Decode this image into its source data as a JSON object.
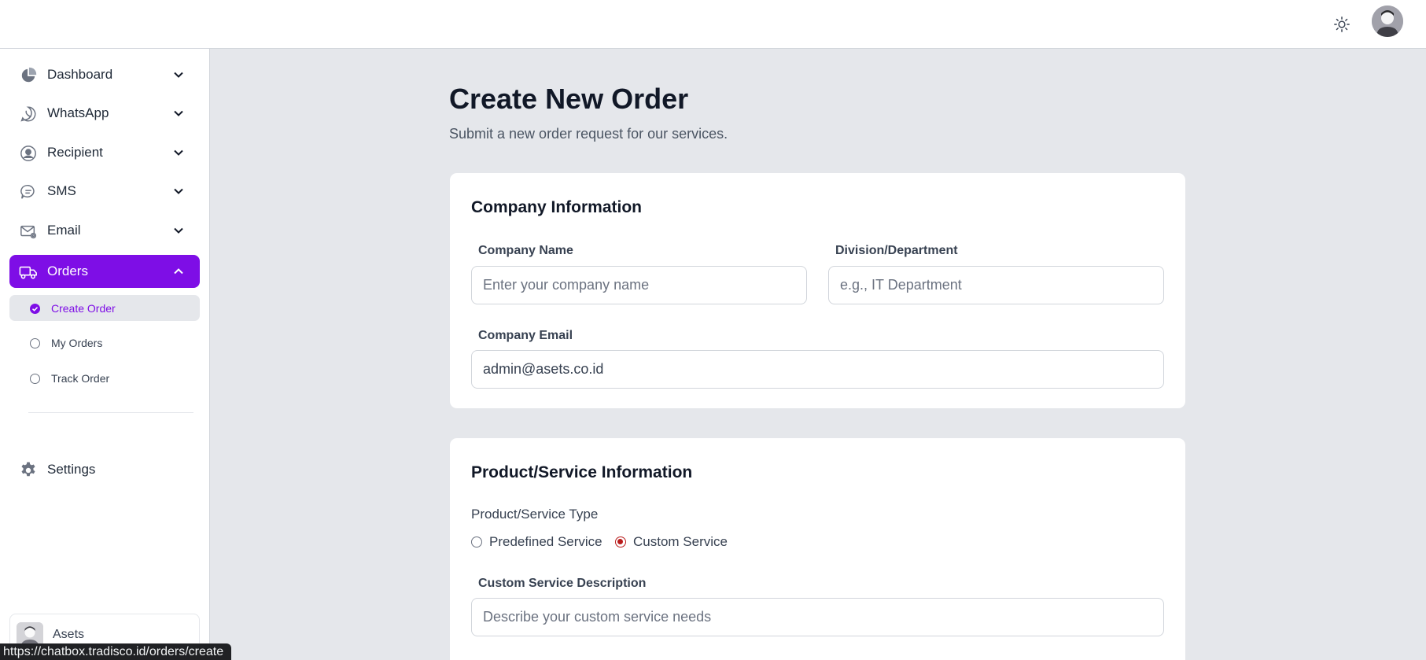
{
  "header": {
    "theme_icon": "sun-icon",
    "avatar_icon": "user-avatar"
  },
  "sidebar": {
    "items": [
      {
        "label": "Dashboard",
        "icon": "pie-chart-icon"
      },
      {
        "label": "WhatsApp",
        "icon": "whatsapp-icon"
      },
      {
        "label": "Recipient",
        "icon": "user-circle-icon"
      },
      {
        "label": "SMS",
        "icon": "chat-bubble-icon"
      },
      {
        "label": "Email",
        "icon": "envelope-icon"
      },
      {
        "label": "Orders",
        "icon": "truck-icon",
        "expanded": true
      }
    ],
    "sub_items": [
      {
        "label": "Create Order",
        "current": true
      },
      {
        "label": "My Orders"
      },
      {
        "label": "Track Order"
      }
    ],
    "settings_label": "Settings",
    "user_name": "Asets"
  },
  "page": {
    "title": "Create New Order",
    "subtitle": "Submit a new order request for our services."
  },
  "company_card": {
    "title": "Company Information",
    "company_name_label": "Company Name",
    "company_name_placeholder": "Enter your company name",
    "division_label": "Division/Department",
    "division_placeholder": "e.g., IT Department",
    "email_label": "Company Email",
    "email_value": "admin@asets.co.id"
  },
  "product_card": {
    "title": "Product/Service Information",
    "type_label": "Product/Service Type",
    "options": [
      {
        "label": "Predefined Service",
        "selected": false
      },
      {
        "label": "Custom Service",
        "selected": true
      }
    ],
    "custom_desc_label": "Custom Service Description",
    "custom_desc_placeholder": "Describe your custom service needs"
  },
  "status_bar_url": "https://chatbox.tradisco.id/orders/create",
  "colors": {
    "accent": "#7e0ee6",
    "radio_selected": "#b91c1c",
    "background": "#e5e7eb"
  }
}
